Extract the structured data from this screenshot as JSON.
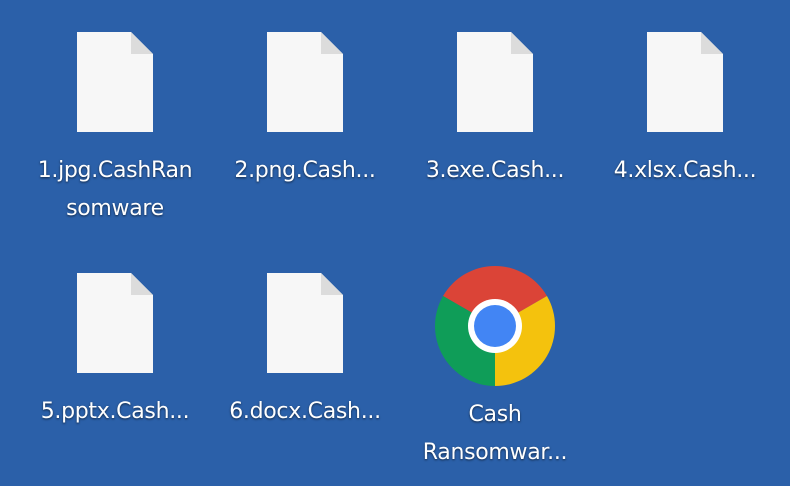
{
  "desktop": {
    "background_color": "#2b60a9",
    "items": [
      {
        "label": "1.jpg.CashRan",
        "label2": "somware",
        "icon": "blank-file-icon"
      },
      {
        "label": "2.png.Cash...",
        "icon": "blank-file-icon"
      },
      {
        "label": "3.exe.Cash...",
        "icon": "blank-file-icon"
      },
      {
        "label": "4.xlsx.Cash...",
        "icon": "blank-file-icon"
      },
      {
        "label": "5.pptx.Cash...",
        "icon": "blank-file-icon"
      },
      {
        "label": "6.docx.Cash...",
        "icon": "blank-file-icon"
      },
      {
        "label": "Cash",
        "label2": "Ransomwar...",
        "icon": "chrome-icon"
      }
    ]
  }
}
